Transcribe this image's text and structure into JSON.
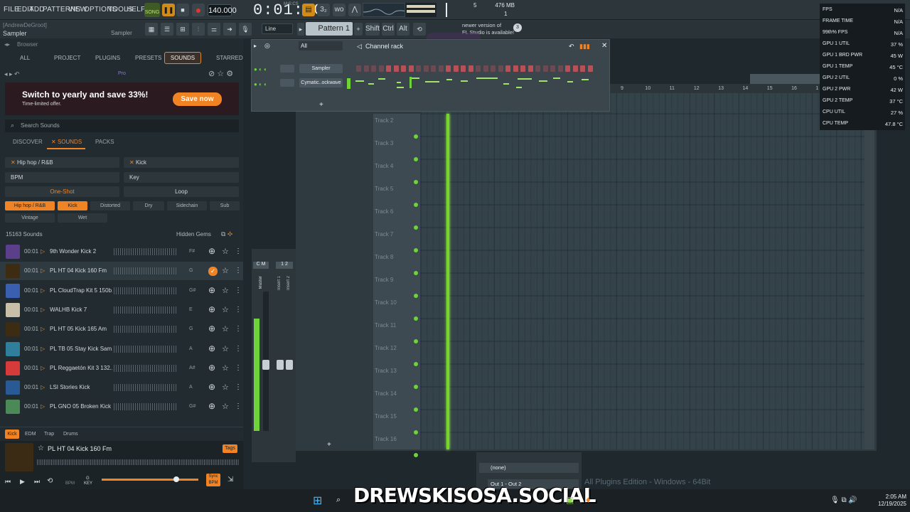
{
  "menu": [
    "FILE",
    "EDIT",
    "ADD",
    "PATTERNS",
    "VIEW",
    "OPTIONS",
    "TOOLS",
    "HELP"
  ],
  "transport": {
    "song": "SONG",
    "tempo": "140.000",
    "time": "0:01:60",
    "time_unit": "M:S:CS"
  },
  "status": {
    "voices": "5",
    "voices2": "1",
    "mem": "476 MB"
  },
  "hint": {
    "user": "[AndrewDeGroot]",
    "left": "Sampler",
    "right": "Sampler"
  },
  "toolbar2": {
    "snap": "Line",
    "pattern": "Pattern 1",
    "shift": "Shift",
    "ctrl": "Ctrl",
    "alt": "Alt",
    "notice1": "newer version of",
    "notice2": "FL Studio is available!",
    "notice_count": "3"
  },
  "browser": {
    "title": "Browser",
    "tabs": [
      "ALL",
      "PROJECT",
      "PLUGINS",
      "PRESETS",
      "SOUNDS",
      "STARRED"
    ],
    "pro": "Pro",
    "banner_title": "Switch to yearly and save 33%!",
    "banner_sub": "Time-limited offer.",
    "banner_btn": "Save now",
    "search": "Search Sounds",
    "subtabs": [
      "DISCOVER",
      "SOUNDS",
      "PACKS"
    ],
    "genre": "Hip hop / R&B",
    "type": "Kick",
    "bpm": "BPM",
    "key": "Key",
    "oneshot": "One-Shot",
    "loop": "Loop",
    "chips": [
      "Hip hop / R&B",
      "Kick",
      "Distorted",
      "Dry",
      "Sidechain",
      "Sub",
      "Vintage",
      "Wet"
    ],
    "count": "15163 Sounds",
    "hidden_gems": "Hidden Gems",
    "rows": [
      {
        "dur": "00:01",
        "name": "9th Wonder Kick 2",
        "key": "F#"
      },
      {
        "dur": "00:01",
        "name": "PL HT 04 Kick 160 Fm",
        "key": "G"
      },
      {
        "dur": "00:01",
        "name": "PL CloudTrap Kit 5 150b...",
        "key": "G#"
      },
      {
        "dur": "00:01",
        "name": "WALHB Kick 7",
        "key": "E"
      },
      {
        "dur": "00:01",
        "name": "PL HT 05 Kick 165 Am",
        "key": "G"
      },
      {
        "dur": "00:01",
        "name": "PL TB 05 Stay Kick Sam...",
        "key": "A"
      },
      {
        "dur": "00:01",
        "name": "PL Reggaetón Kit 3 132...",
        "key": "A#"
      },
      {
        "dur": "00:01",
        "name": "LSI Stories Kick",
        "key": "A"
      },
      {
        "dur": "00:01",
        "name": "PL GNO 05 Broken Kick ...",
        "key": "G#"
      }
    ],
    "bottom_tags": [
      "Kick",
      "EDM",
      "Trap",
      "Drums"
    ],
    "preview_name": "PL HT 04 Kick 160 Fm",
    "preview_tags": "Tags",
    "bpm_label": "BPM",
    "key_label": "KEY",
    "key_val": "G",
    "sync": "Sync BPM"
  },
  "rack": {
    "filter": "All",
    "title": "Channel rack",
    "channels": [
      "Sampler",
      "Cymatic..ockwave"
    ],
    "add": "+"
  },
  "mixer": {
    "master": "Master",
    "insert1": "Insert 1",
    "insert2": "Insert 2",
    "c": "C",
    "m": "M",
    "n1": "1",
    "n2": "2"
  },
  "playlist": {
    "tracks": [
      "Track 2",
      "Track 3",
      "Track 4",
      "Track 5",
      "Track 6",
      "Track 7",
      "Track 8",
      "Track 9",
      "Track 10",
      "Track 11",
      "Track 12",
      "Track 13",
      "Track 14",
      "Track 15",
      "Track 16"
    ],
    "ruler": [
      "9",
      "10",
      "11",
      "12",
      "13",
      "14",
      "15",
      "16",
      "1"
    ]
  },
  "stats": [
    {
      "l": "FPS",
      "v": "N/A"
    },
    {
      "l": "FRAME TIME",
      "v": "N/A"
    },
    {
      "l": "99th% FPS",
      "v": "N/A"
    },
    {
      "l": "GPU 1 UTIL",
      "v": "37 %"
    },
    {
      "l": "GPU 1 BRD PWR",
      "v": "45 W"
    },
    {
      "l": "GPU 1 TEMP",
      "v": "45 °C"
    },
    {
      "l": "GPU 2 UTIL",
      "v": "0 %"
    },
    {
      "l": "GPU 2 PWR",
      "v": "42 W"
    },
    {
      "l": "GPU 2 TEMP",
      "v": "37 °C"
    },
    {
      "l": "CPU UTIL",
      "v": "27 %"
    },
    {
      "l": "CPU TEMP",
      "v": "47.8 °C"
    }
  ],
  "bottom": {
    "none": "(none)",
    "out": "Out 1 - Out 2",
    "edition": "All Plugins Edition - Windows - 64Bit"
  },
  "watermark": "DREWSKISOSA.SOCIAL",
  "overlay_logo": "DREWSKI SOSA",
  "clock": {
    "time": "2:05 AM",
    "date": "12/19/2025"
  },
  "colors": {
    "accent": "#f08425",
    "playhead": "#76d42b",
    "bg": "#1f282d"
  }
}
